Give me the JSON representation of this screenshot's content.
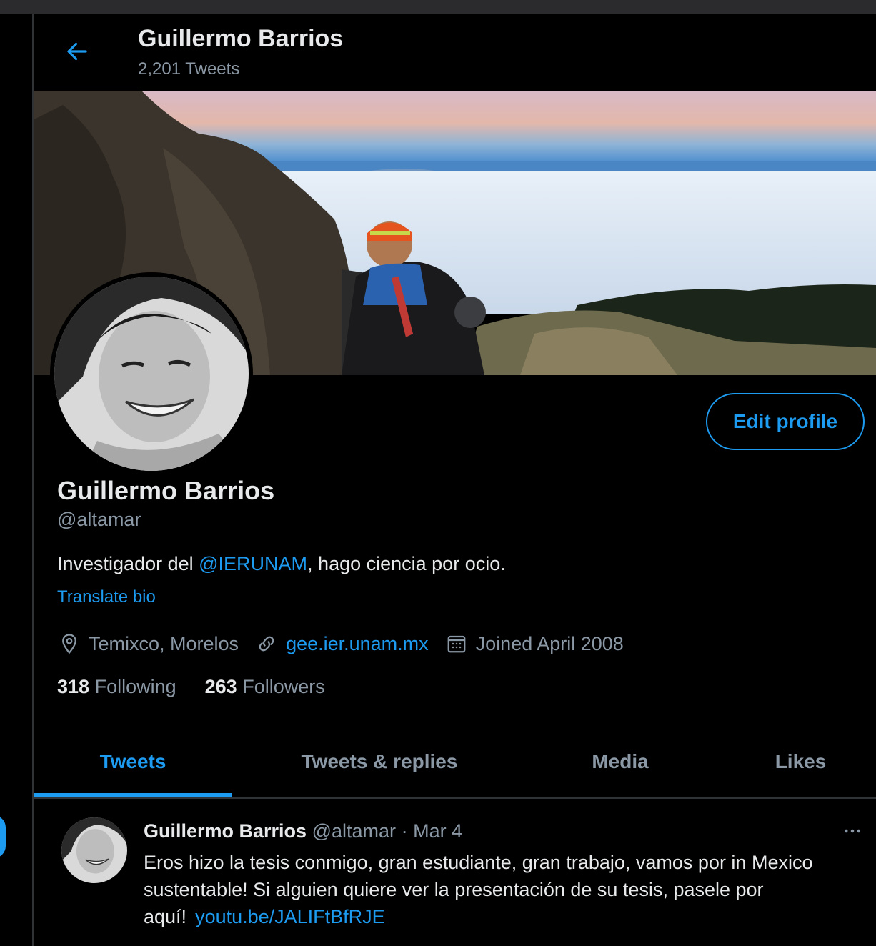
{
  "header": {
    "name": "Guillermo Barrios",
    "tweet_count": "2,201 Tweets"
  },
  "icons": {
    "back": "arrow-left-icon",
    "location": "location-pin-icon",
    "link": "link-icon",
    "calendar": "calendar-icon",
    "more": "more-horizontal-icon"
  },
  "profile": {
    "edit_label": "Edit profile",
    "name": "Guillermo Barrios",
    "handle": "@altamar",
    "bio_prefix": "Investigador del ",
    "bio_mention": "@IERUNAM",
    "bio_suffix": ", hago ciencia por ocio.",
    "translate_label": "Translate bio",
    "location": "Temixco, Morelos",
    "website": "gee.ier.unam.mx",
    "joined": "Joined April 2008",
    "following_count": "318",
    "following_label": "Following",
    "followers_count": "263",
    "followers_label": "Followers"
  },
  "tabs": [
    {
      "label": "Tweets",
      "active": true
    },
    {
      "label": "Tweets & replies",
      "active": false
    },
    {
      "label": "Media",
      "active": false
    },
    {
      "label": "Likes",
      "active": false
    }
  ],
  "tweet": {
    "author": "Guillermo Barrios",
    "handle": "@altamar",
    "separator": "·",
    "date": "Mar 4",
    "text": "Eros hizo la tesis conmigo, gran estudiante, gran trabajo, vamos por in Mexico sustentable! Si alguien quiere ver la presentación de su tesis, pasele por aquí!",
    "link": "youtu.be/JALIFtBfRJE"
  },
  "colors": {
    "accent": "#1d9bf0",
    "background": "#000000",
    "secondary_text": "#8b98a5",
    "border": "#2f3336"
  }
}
